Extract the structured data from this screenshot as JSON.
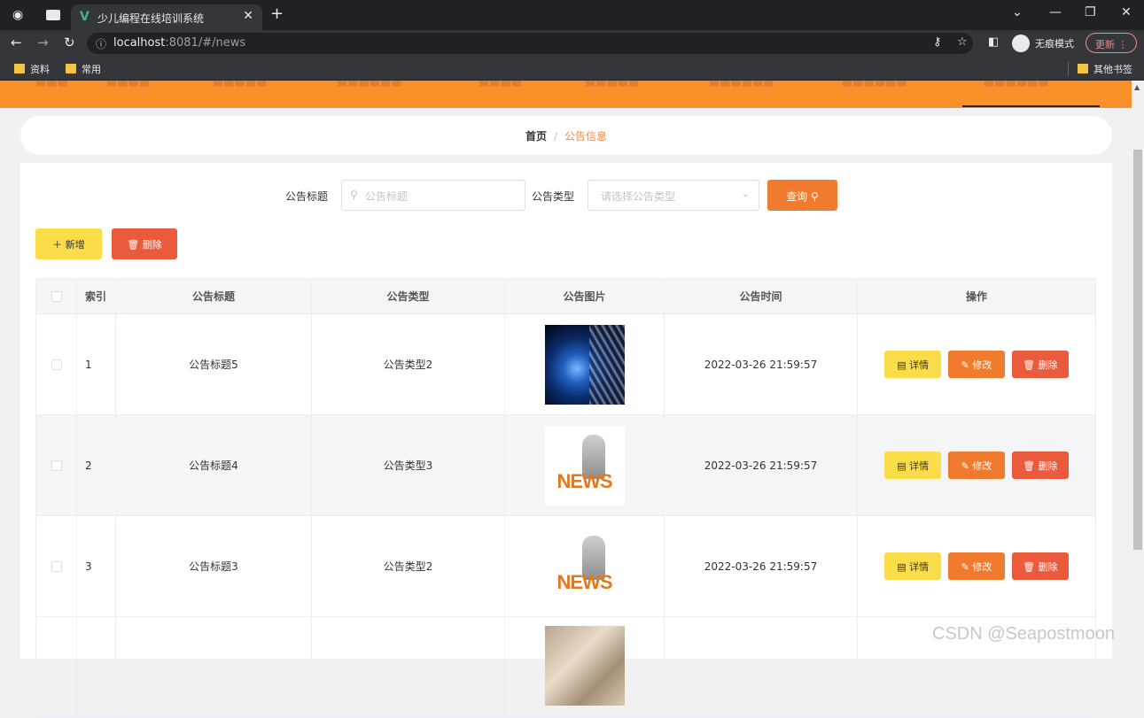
{
  "browser": {
    "tab_title": "少儿编程在线培训系统",
    "url_host": "localhost",
    "url_path": ":8081/#/news",
    "incognito_label": "无痕模式",
    "update_label": "更新",
    "bookmarks": [
      "资料",
      "常用"
    ],
    "other_bookmarks": "其他书签"
  },
  "breadcrumb": {
    "home": "首页",
    "separator": "/",
    "current": "公告信息"
  },
  "search": {
    "title_label": "公告标题",
    "title_placeholder": "公告标题",
    "type_label": "公告类型",
    "type_placeholder": "请选择公告类型",
    "query_button": "查询"
  },
  "toolbar": {
    "add_button": "新增",
    "delete_button": "删除"
  },
  "table": {
    "columns": [
      "索引",
      "公告标题",
      "公告类型",
      "公告图片",
      "公告时间",
      "操作"
    ],
    "rows": [
      {
        "index": "1",
        "title": "公告标题5",
        "type": "公告类型2",
        "image": "globe-image",
        "time": "2022-03-26 21:59:57"
      },
      {
        "index": "2",
        "title": "公告标题4",
        "type": "公告类型3",
        "image": "news-image",
        "time": "2022-03-26 21:59:57"
      },
      {
        "index": "3",
        "title": "公告标题3",
        "type": "公告类型2",
        "image": "news-image",
        "time": "2022-03-26 21:59:57"
      },
      {
        "index": "",
        "title": "",
        "type": "",
        "image": "paper-image",
        "time": ""
      }
    ],
    "actions": {
      "detail": "详情",
      "edit": "修改",
      "delete": "删除"
    }
  },
  "watermark": "CSDN @Seapostmoon",
  "colors": {
    "nav": "#f8912a",
    "query": "#f07b2f",
    "add": "#fbdd4a",
    "delete": "#ea5a3c",
    "link": "#f08c3c"
  }
}
